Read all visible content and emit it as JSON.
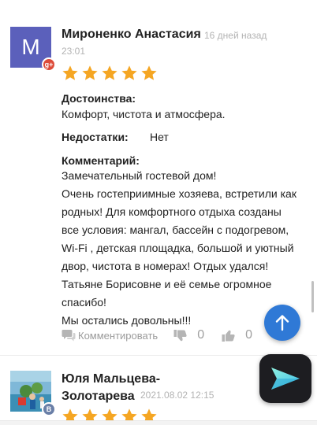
{
  "review1": {
    "avatar_letter": "M",
    "network_badge": "g+",
    "author": "Мироненко Анастасия",
    "date": "16 дней назад",
    "time": "23:01",
    "rating": 5,
    "pros_label": "Достоинства:",
    "pros_text": "Комфорт, чистота и атмосфера.",
    "cons_label": "Недостатки:",
    "cons_text": "Нет",
    "comment_label": "Комментарий:",
    "comment_lines": [
      "Замечательный гостевой дом!",
      "Очень гостеприимные  хозяева, встретили как",
      "родных! Для комфортного отдыха созданы",
      "все условия: мангал,  бассейн с подогревом,",
      "Wi-Fi , детская площадка, большой и уютный",
      "двор, чистота в номерах! Отдых удался!",
      "Татьяне Борисовне и её семье огромное",
      "спасибо!",
      "Мы остались довольны!!!"
    ],
    "comment_action": "Комментировать",
    "dislikes": "0",
    "likes": "0"
  },
  "review2": {
    "network_badge": "B",
    "author_line1": "Юля Мальцева-",
    "author_line2": "Золотарева",
    "date": "2021.08.02 12:15",
    "rating": 5
  },
  "colors": {
    "star": "#f5a623",
    "avatar_bg": "#5b60bb",
    "fab": "#2f79d6",
    "telegram_bg": "#1d1d21"
  },
  "icons": [
    "google-plus-icon",
    "star-icon",
    "comment-icon",
    "thumb-down-icon",
    "thumb-up-icon",
    "arrow-up-icon",
    "send-icon",
    "vk-icon"
  ]
}
